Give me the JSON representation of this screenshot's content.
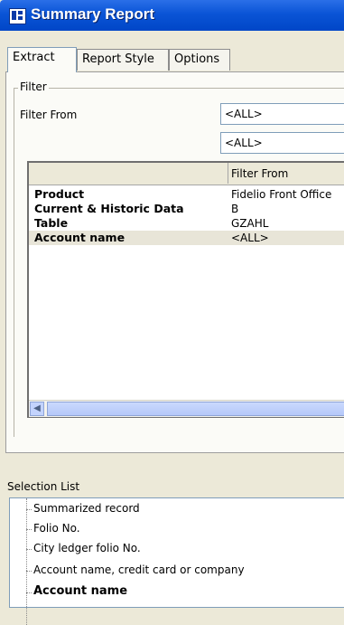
{
  "window": {
    "title": "Summary Report"
  },
  "tabs": [
    {
      "label": "Extract",
      "active": true
    },
    {
      "label": "Report Style",
      "active": false
    },
    {
      "label": "Options",
      "active": false
    }
  ],
  "filter": {
    "group_label": "Filter",
    "filter_from_label": "Filter From",
    "input1_value": "<ALL>",
    "input2_value": "<ALL>"
  },
  "grid": {
    "column_header": "Filter From",
    "rows": [
      {
        "key": "Product",
        "value": "Fidelio Front Office"
      },
      {
        "key": "Current & Historic Data",
        "value": "B"
      },
      {
        "key": "Table",
        "value": "GZAHL"
      },
      {
        "key": "Account name",
        "value": "<ALL>"
      }
    ]
  },
  "selection_list": {
    "label": "Selection List",
    "items": [
      {
        "label": "Summarized record"
      },
      {
        "label": "Folio No."
      },
      {
        "label": "City ledger folio No."
      },
      {
        "label": "Account name, credit card or company"
      },
      {
        "label": "Account name"
      }
    ]
  },
  "colors": {
    "title_bar": "#0a54d6",
    "panel": "#ece9d8",
    "field_border": "#7f9db9"
  }
}
